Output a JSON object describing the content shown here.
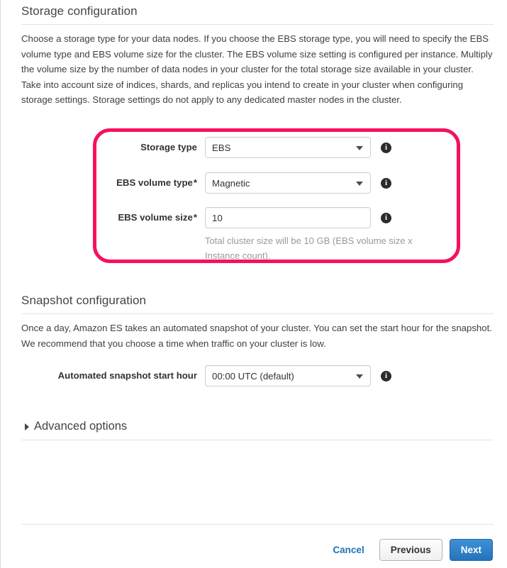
{
  "storage": {
    "title": "Storage configuration",
    "description": "Choose a storage type for your data nodes. If you choose the EBS storage type, you will need to specify the EBS volume type and EBS volume size for the cluster. The EBS volume size setting is configured per instance. Multiply the volume size by the number of data nodes in your cluster for the total storage size available in your cluster. Take into account size of indices, shards, and replicas you intend to create in your cluster when configuring storage settings. Storage settings do not apply to any dedicated master nodes in the cluster.",
    "fields": {
      "storage_type": {
        "label": "Storage type",
        "value": "EBS",
        "required": false
      },
      "ebs_volume_type": {
        "label": "EBS volume type",
        "value": "Magnetic",
        "required": true,
        "required_marker": "*"
      },
      "ebs_volume_size": {
        "label": "EBS volume size",
        "value": "10",
        "required": true,
        "required_marker": "*",
        "helper": "Total cluster size will be 10 GB (EBS volume size x Instance count)."
      }
    },
    "info_icon": "i"
  },
  "snapshot": {
    "title": "Snapshot configuration",
    "description": "Once a day, Amazon ES takes an automated snapshot of your cluster. You can set the start hour for the snapshot. We recommend that you choose a time when traffic on your cluster is low.",
    "fields": {
      "start_hour": {
        "label": "Automated snapshot start hour",
        "value": "00:00 UTC (default)"
      }
    }
  },
  "advanced": {
    "label": "Advanced options",
    "expanded": false
  },
  "footer": {
    "cancel_label": "Cancel",
    "previous_label": "Previous",
    "next_label": "Next"
  },
  "colors": {
    "highlight": "#f5125c",
    "primary_button": "#2573ba",
    "link": "#2072b8",
    "helper_text": "#999999"
  }
}
